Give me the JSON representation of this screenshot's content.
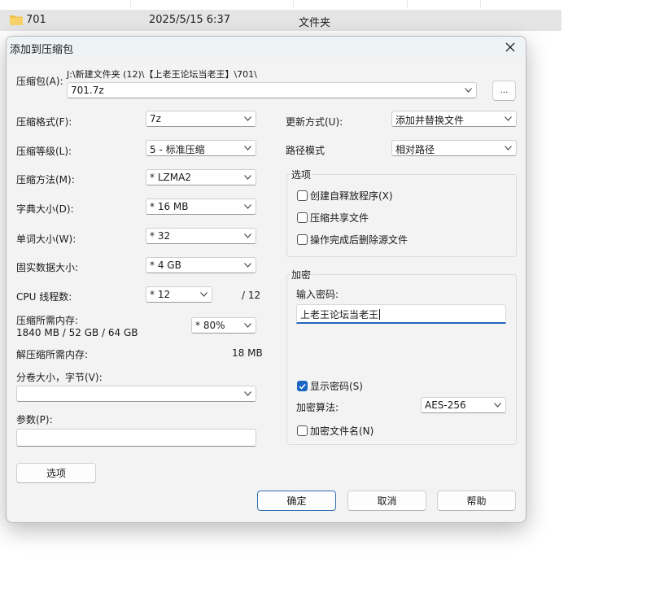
{
  "explorer": {
    "name": "701",
    "date": "2025/5/15 6:37",
    "type": "文件夹"
  },
  "dialog": {
    "title": "添加到压缩包",
    "archive": {
      "label": "压缩包(A):",
      "path": "J:\\新建文件夹 (12)\\【上老王论坛当老王】\\701\\",
      "name": "701.7z",
      "browse_label": "..."
    },
    "left": {
      "format": {
        "label": "压缩格式(F):",
        "value": "7z"
      },
      "level": {
        "label": "压缩等级(L):",
        "value": "5 - 标准压缩"
      },
      "method": {
        "label": "压缩方法(M):",
        "value": "*  LZMA2"
      },
      "dict": {
        "label": "字典大小(D):",
        "value": "*  16 MB"
      },
      "word": {
        "label": "单词大小(W):",
        "value": "*  32"
      },
      "solid": {
        "label": "固实数据大小:",
        "value": "*  4 GB"
      },
      "cpu": {
        "label": "CPU 线程数:",
        "value": "*  12",
        "total": "/ 12"
      },
      "mem_compress": {
        "label": "压缩所需内存:",
        "detail": "1840 MB / 52 GB / 64 GB",
        "value": "*  80%"
      },
      "mem_decompress": {
        "label": "解压缩所需内存:",
        "value": "18 MB"
      },
      "volume": {
        "label": "分卷大小，字节(V):",
        "value": ""
      },
      "params": {
        "label": "参数(P):",
        "value": ""
      },
      "options_button": "选项"
    },
    "right": {
      "update": {
        "label": "更新方式(U):",
        "value": "添加并替换文件"
      },
      "pathmode": {
        "label": "路径模式",
        "value": "相对路径"
      },
      "options_group": {
        "title": "选项",
        "sfx": {
          "label": "创建自释放程序(X)",
          "checked": false
        },
        "shared": {
          "label": "压缩共享文件",
          "checked": false
        },
        "delete": {
          "label": "操作完成后删除源文件",
          "checked": false
        }
      },
      "encryption_group": {
        "title": "加密",
        "password_label": "输入密码:",
        "password": "上老王论坛当老王",
        "show_password": {
          "label": "显示密码(S)",
          "checked": true
        },
        "algorithm_label": "加密算法:",
        "algorithm": "AES-256",
        "encrypt_names": {
          "label": "加密文件名(N)",
          "checked": false
        }
      }
    },
    "buttons": {
      "ok": "确定",
      "cancel": "取消",
      "help": "帮助"
    }
  },
  "colors": {
    "accent": "#1a66c2",
    "folder": "#f2c24b",
    "dialog_bg": "#f3f3f3"
  }
}
